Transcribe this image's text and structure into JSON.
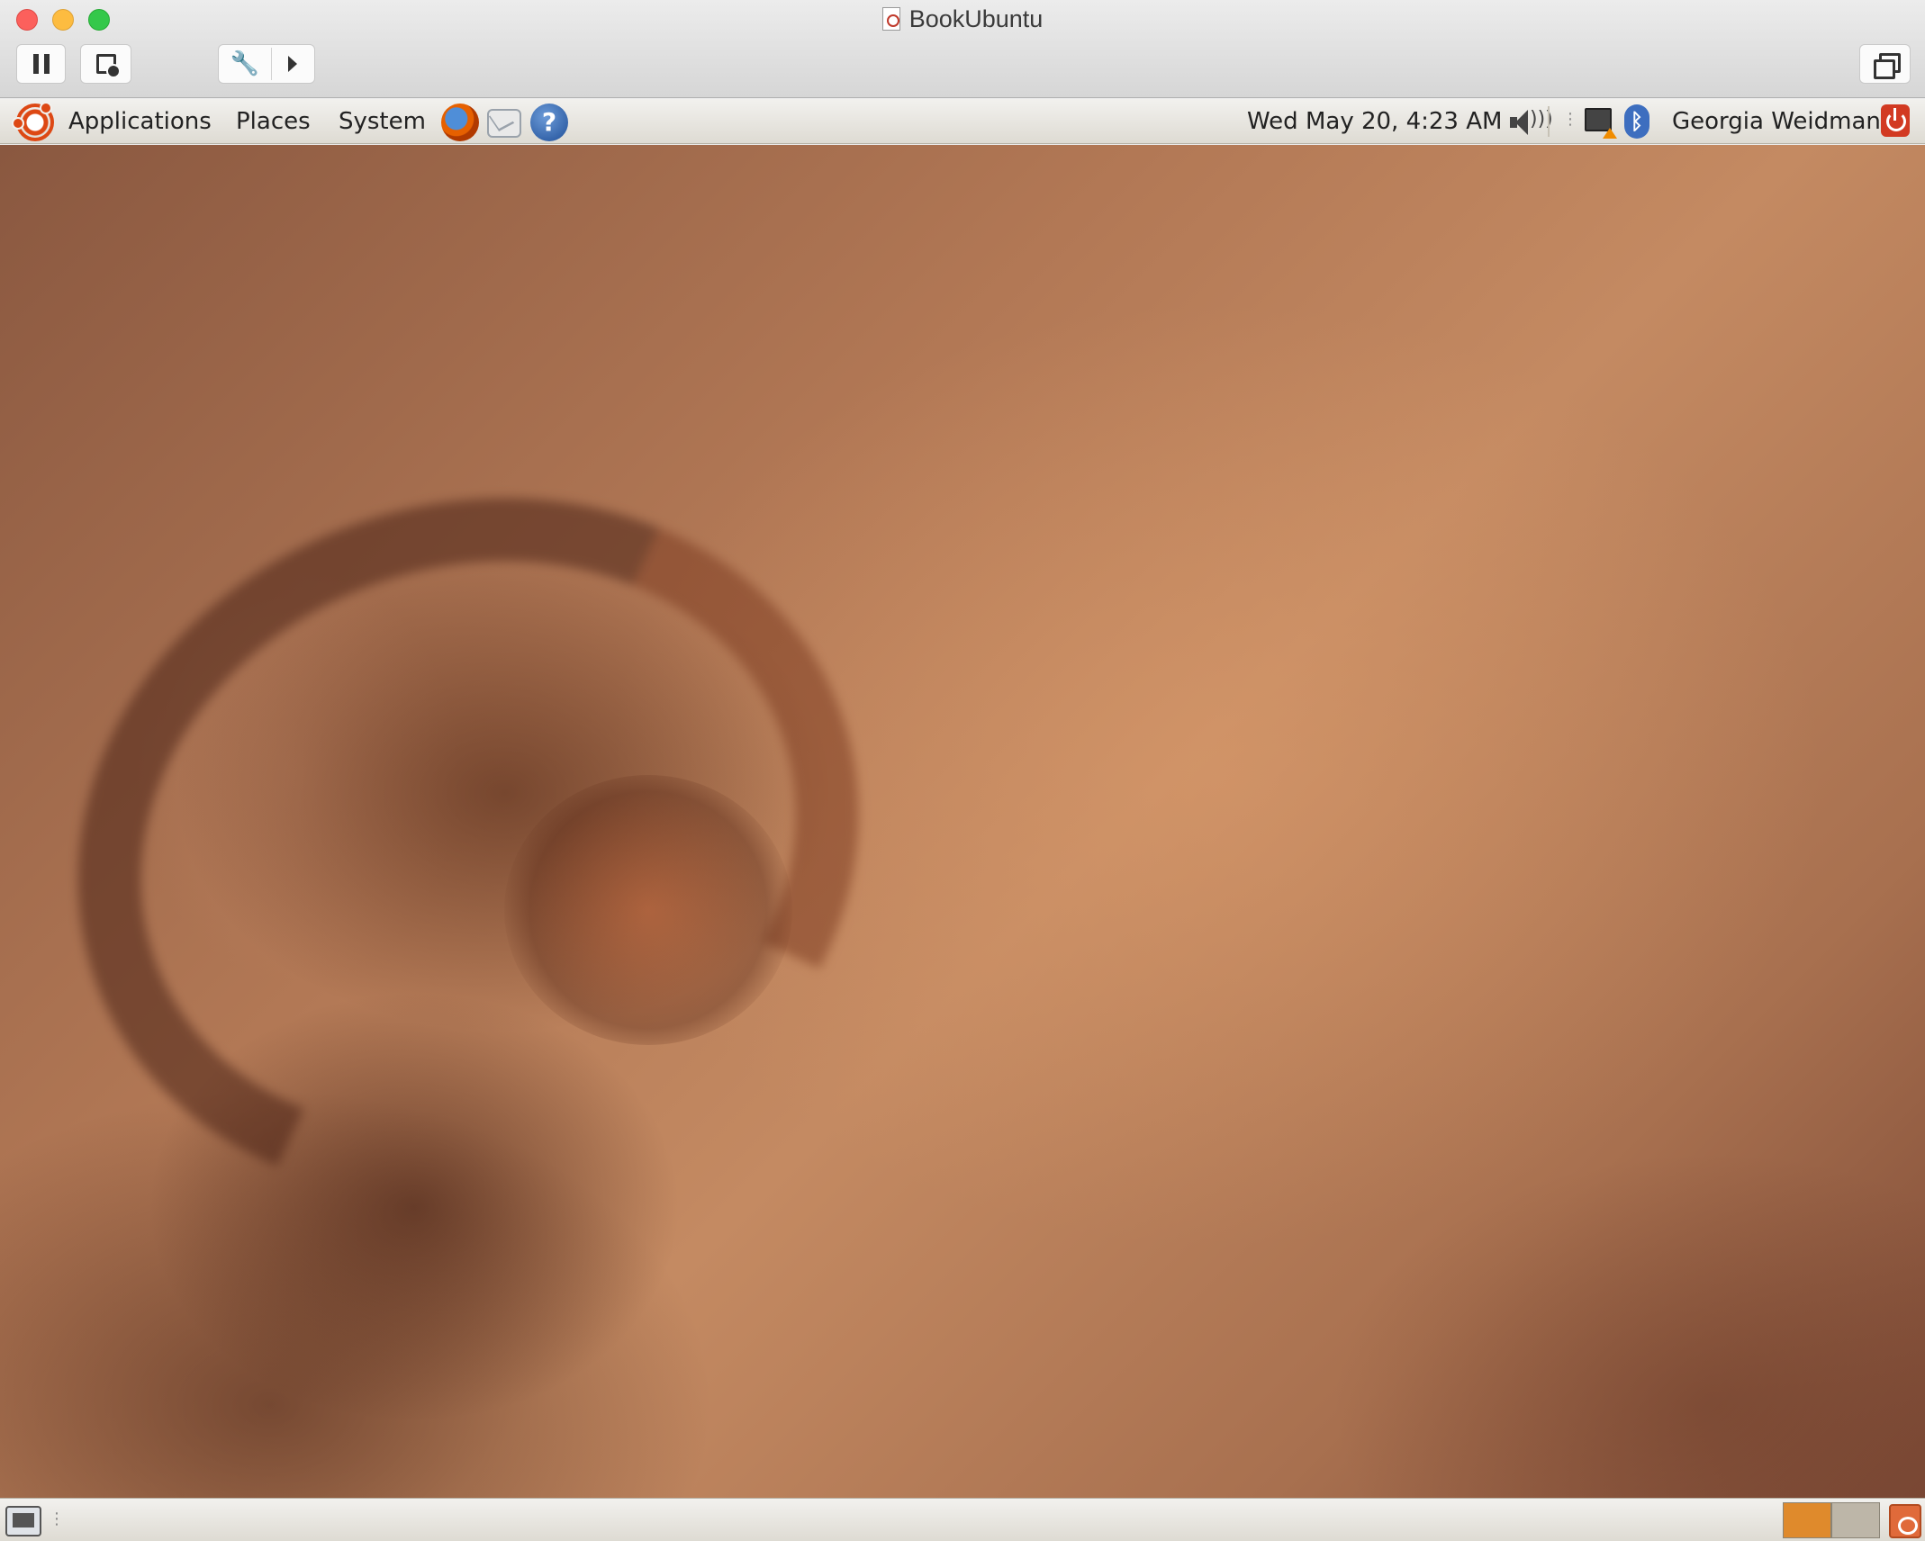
{
  "window": {
    "title": "BookUbuntu"
  },
  "toolbar": {
    "buttons": [
      "pause",
      "snapshot",
      "settings",
      "restore"
    ]
  },
  "top_panel": {
    "menus": [
      "Applications",
      "Places",
      "System"
    ],
    "launchers": [
      "firefox-icon",
      "mail-icon",
      "help-icon"
    ],
    "clock": "Wed May 20,  4:23 AM",
    "user": "Georgia Weidman",
    "tray_icons": [
      "volume-icon",
      "network-icon",
      "bluetooth-icon",
      "power-icon"
    ]
  },
  "bottom_panel": {
    "icons": [
      "show-desktop-icon",
      "workspace-switcher",
      "trash-icon"
    ]
  },
  "colors": {
    "accent": "#dd4814",
    "panel": "#ece9e3",
    "workspace_active": "#df8a2c"
  }
}
